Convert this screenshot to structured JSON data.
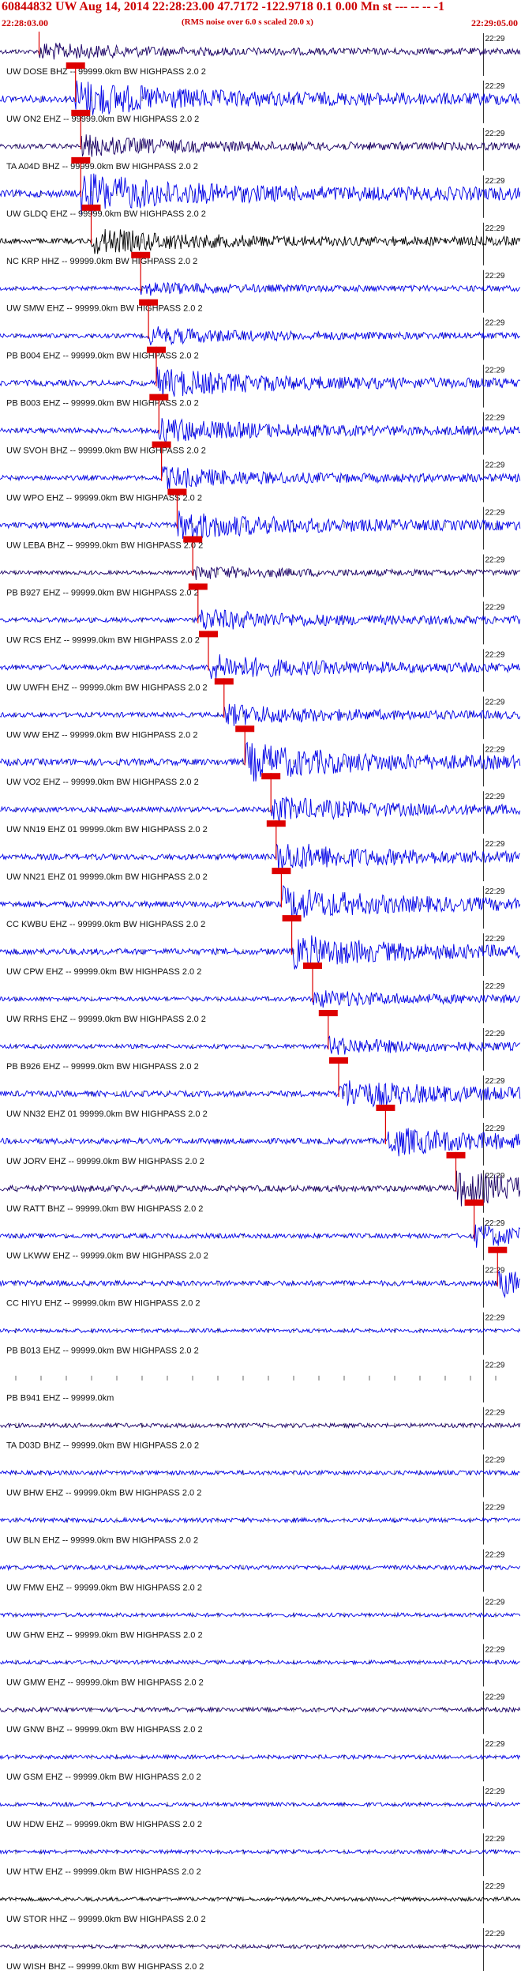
{
  "header": {
    "title": "60844832 UW Aug 14, 2014 22:28:23.00   47.7172 -122.9718  0.1 0.00 Mn st --- -- --  -1",
    "start_time": "22:28:03.00",
    "note": "(RMS noise over 6.0 s scaled 20.0 x)",
    "end_time": "22:29:05.00"
  },
  "colors": {
    "trace": "#0000e6",
    "dark_trace": "#1a0066",
    "black_trace": "#000000",
    "pick": "#dd0000",
    "text": "#cc0000"
  },
  "chart_data": {
    "type": "line",
    "title": "60844832 UW Aug 14, 2014 22:28:23.00   47.7172 -122.9718  0.1 0.00 Mn st --- -- --  -1",
    "x_start": "22:28:03.00",
    "x_end": "22:29:05.00",
    "minute_tick_label": "22:29",
    "channels": [
      {
        "label": "UW DOSE BHZ -- 99999.0km BW  HIGHPASS  2.0  2",
        "amp": 0.4,
        "pick": 0.075,
        "color": "dark"
      },
      {
        "label": "UW ON2 EHZ -- 99999.0km BW  HIGHPASS  2.0  2",
        "amp": 0.9,
        "pick": 0.145,
        "color": "blue"
      },
      {
        "label": "TA A04D BHZ -- 99999.0km BW  HIGHPASS  2.0  2",
        "amp": 0.5,
        "pick": 0.155,
        "color": "dark"
      },
      {
        "label": "UW GLDQ EHZ -- 99999.0km BW  HIGHPASS  2.0  2",
        "amp": 1.0,
        "pick": 0.155,
        "color": "blue"
      },
      {
        "label": "NC KRP HHZ -- 99999.0km BW  HIGHPASS  2.0  2",
        "amp": 0.6,
        "pick": 0.175,
        "color": "black"
      },
      {
        "label": "UW SMW EHZ -- 99999.0km BW  HIGHPASS  2.0  2",
        "amp": 0.3,
        "pick": 0.27,
        "color": "blue"
      },
      {
        "label": "PB B004 EHZ -- 99999.0km BW  HIGHPASS  2.0  2",
        "amp": 0.4,
        "pick": 0.285,
        "color": "blue"
      },
      {
        "label": "PB B003 EHZ -- 99999.0km BW  HIGHPASS  2.0  2",
        "amp": 0.7,
        "pick": 0.3,
        "color": "blue"
      },
      {
        "label": "UW SVOH BHZ -- 99999.0km BW  HIGHPASS  2.0  2",
        "amp": 0.6,
        "pick": 0.305,
        "color": "blue"
      },
      {
        "label": "UW WPO EHZ -- 99999.0km BW  HIGHPASS  2.0  2",
        "amp": 0.5,
        "pick": 0.31,
        "color": "blue"
      },
      {
        "label": "UW LEBA BHZ -- 99999.0km BW  HIGHPASS  2.0  2",
        "amp": 0.7,
        "pick": 0.34,
        "color": "blue"
      },
      {
        "label": "PB B927 EHZ -- 99999.0km BW  HIGHPASS  2.0  2",
        "amp": 0.3,
        "pick": 0.37,
        "color": "dark"
      },
      {
        "label": "UW RCS EHZ -- 99999.0km BW  HIGHPASS  2.0  2",
        "amp": 0.5,
        "pick": 0.38,
        "color": "blue"
      },
      {
        "label": "UW UWFH EHZ -- 99999.0km BW  HIGHPASS  2.0  2",
        "amp": 0.6,
        "pick": 0.4,
        "color": "blue"
      },
      {
        "label": "UW WW EHZ -- 99999.0km BW  HIGHPASS  2.0  2",
        "amp": 0.5,
        "pick": 0.43,
        "color": "blue"
      },
      {
        "label": "UW VO2 EHZ -- 99999.0km BW  HIGHPASS  2.0  2",
        "amp": 0.9,
        "pick": 0.47,
        "color": "blue"
      },
      {
        "label": "UW NN19 EHZ 01 99999.0km BW  HIGHPASS  2.0  2",
        "amp": 0.6,
        "pick": 0.52,
        "color": "blue"
      },
      {
        "label": "UW NN21 EHZ 01 99999.0km BW  HIGHPASS  2.0  2",
        "amp": 0.7,
        "pick": 0.53,
        "color": "blue"
      },
      {
        "label": "CC KWBU EHZ -- 99999.0km BW  HIGHPASS  2.0  2",
        "amp": 0.8,
        "pick": 0.54,
        "color": "blue"
      },
      {
        "label": "UW CPW EHZ -- 99999.0km BW  HIGHPASS  2.0  2",
        "amp": 0.8,
        "pick": 0.56,
        "color": "blue"
      },
      {
        "label": "UW RRHS EHZ -- 99999.0km BW  HIGHPASS  2.0  2",
        "amp": 0.4,
        "pick": 0.6,
        "color": "blue"
      },
      {
        "label": "PB B926 EHZ -- 99999.0km BW  HIGHPASS  2.0  2",
        "amp": 0.4,
        "pick": 0.63,
        "color": "blue"
      },
      {
        "label": "UW NN32 EHZ 01 99999.0km BW  HIGHPASS  2.0  2",
        "amp": 0.7,
        "pick": 0.65,
        "color": "blue"
      },
      {
        "label": "UW JORV EHZ -- 99999.0km BW  HIGHPASS  2.0  2",
        "amp": 0.7,
        "pick": 0.74,
        "color": "blue"
      },
      {
        "label": "UW RATT BHZ -- 99999.0km BW  HIGHPASS  2.0  2",
        "amp": 0.8,
        "pick": 0.875,
        "color": "dark"
      },
      {
        "label": "UW LKWW EHZ -- 99999.0km BW  HIGHPASS  2.0  2",
        "amp": 0.5,
        "pick": 0.91,
        "color": "blue"
      },
      {
        "label": "CC HIYU EHZ -- 99999.0km BW  HIGHPASS  2.0  2",
        "amp": 0.6,
        "pick": 0.955,
        "color": "blue"
      },
      {
        "label": "PB B013 EHZ -- 99999.0km BW  HIGHPASS  2.0  2",
        "amp": 0.3,
        "pick": null,
        "color": "blue"
      },
      {
        "label": "PB B941 EHZ -- 99999.0km",
        "amp": 0.0,
        "pick": null,
        "color": "blue"
      },
      {
        "label": "TA D03D BHZ -- 99999.0km BW  HIGHPASS  2.0  2",
        "amp": 0.4,
        "pick": null,
        "color": "dark"
      },
      {
        "label": "UW BHW EHZ -- 99999.0km BW  HIGHPASS  2.0  2",
        "amp": 0.4,
        "pick": null,
        "color": "blue"
      },
      {
        "label": "UW BLN EHZ -- 99999.0km BW  HIGHPASS  2.0  2",
        "amp": 0.4,
        "pick": null,
        "color": "blue"
      },
      {
        "label": "UW FMW EHZ -- 99999.0km BW  HIGHPASS  2.0  2",
        "amp": 0.4,
        "pick": null,
        "color": "blue"
      },
      {
        "label": "UW GHW EHZ -- 99999.0km BW  HIGHPASS  2.0  2",
        "amp": 0.3,
        "pick": null,
        "color": "blue"
      },
      {
        "label": "UW GMW EHZ -- 99999.0km BW  HIGHPASS  2.0  2",
        "amp": 0.3,
        "pick": null,
        "color": "blue"
      },
      {
        "label": "UW GNW BHZ -- 99999.0km BW  HIGHPASS  2.0  2",
        "amp": 0.4,
        "pick": null,
        "color": "dark"
      },
      {
        "label": "UW GSM EHZ -- 99999.0km BW  HIGHPASS  2.0  2",
        "amp": 0.3,
        "pick": null,
        "color": "blue"
      },
      {
        "label": "UW HDW EHZ -- 99999.0km BW  HIGHPASS  2.0  2",
        "amp": 0.3,
        "pick": null,
        "color": "blue"
      },
      {
        "label": "UW HTW EHZ -- 99999.0km BW  HIGHPASS  2.0  2",
        "amp": 0.3,
        "pick": null,
        "color": "blue"
      },
      {
        "label": "UW STOR HHZ -- 99999.0km BW  HIGHPASS  2.0  2",
        "amp": 0.3,
        "pick": null,
        "color": "black"
      },
      {
        "label": "UW WISH BHZ -- 99999.0km BW  HIGHPASS  2.0  2",
        "amp": 0.3,
        "pick": null,
        "color": "dark"
      }
    ]
  }
}
